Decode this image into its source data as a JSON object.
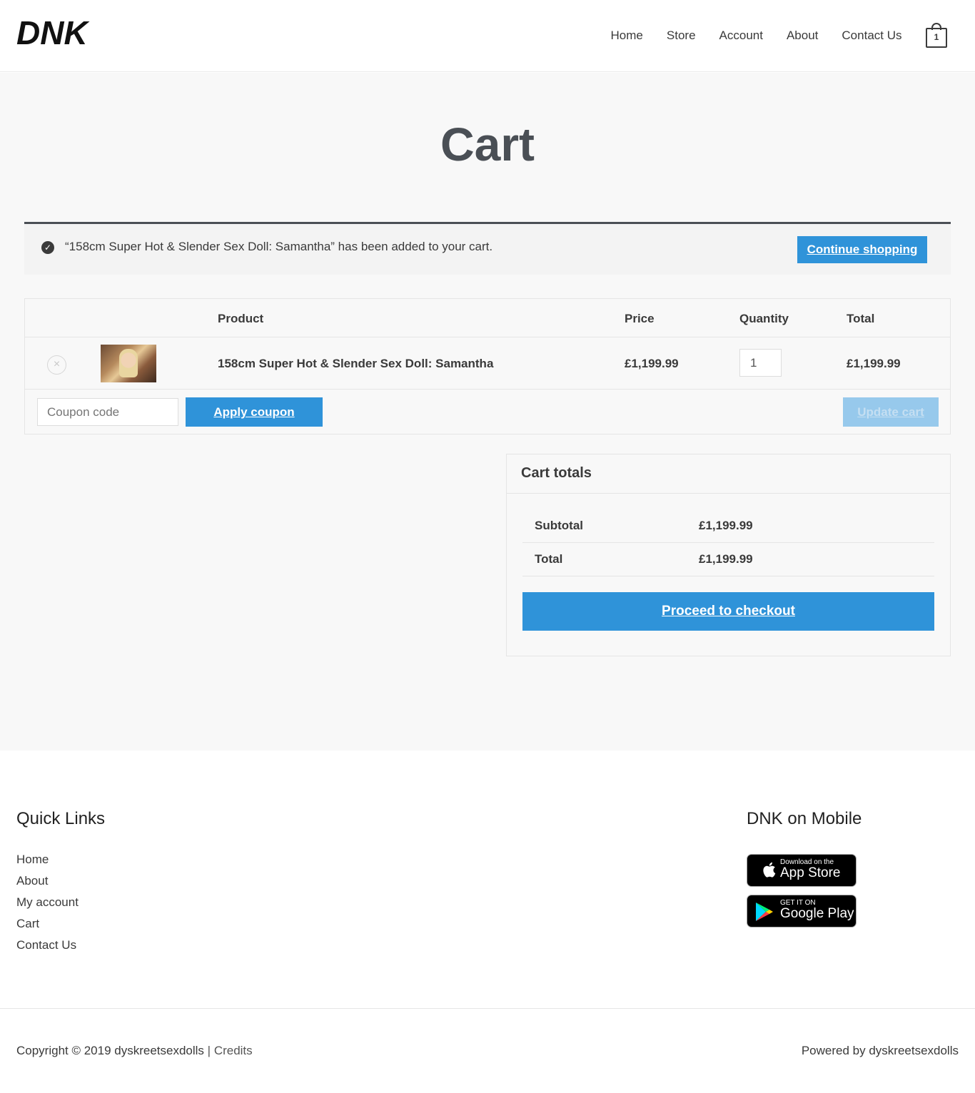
{
  "header": {
    "logo_text": "DNK",
    "nav": [
      "Home",
      "Store",
      "Account",
      "About",
      "Contact Us"
    ],
    "cart_count": "1"
  },
  "page": {
    "title": "Cart"
  },
  "notice": {
    "message": "“158cm Super Hot & Slender Sex Doll: Samantha” has been added to your cart.",
    "continue_label": "Continue shopping"
  },
  "cart": {
    "headers": {
      "product": "Product",
      "price": "Price",
      "quantity": "Quantity",
      "total": "Total"
    },
    "items": [
      {
        "name": "158cm Super Hot & Slender Sex Doll: Samantha",
        "price": "£1,199.99",
        "quantity": "1",
        "total": "£1,199.99"
      }
    ],
    "coupon_placeholder": "Coupon code",
    "apply_label": "Apply coupon",
    "update_label": "Update cart"
  },
  "totals": {
    "title": "Cart totals",
    "subtotal_label": "Subtotal",
    "subtotal_value": "£1,199.99",
    "total_label": "Total",
    "total_value": "£1,199.99",
    "checkout_label": "Proceed to checkout"
  },
  "footer": {
    "quick_links_title": "Quick Links",
    "quick_links": [
      "Home",
      "About",
      "My account",
      "Cart",
      "Contact Us"
    ],
    "mobile_title": "DNK on Mobile",
    "app_store": {
      "small": "Download on the",
      "big": "App Store"
    },
    "google_play": {
      "small": "GET IT ON",
      "big": "Google Play"
    },
    "copyright": "Copyright © 2019 dyskreetsexdolls",
    "separator": " | ",
    "credits": "Credits",
    "powered": "Powered by dyskreetsexdolls"
  },
  "colors": {
    "accent": "#2f93d9",
    "accent_disabled": "#97c9ec",
    "text": "#3a3a3a",
    "title": "#4a4f55",
    "bg": "#f8f8f8"
  }
}
